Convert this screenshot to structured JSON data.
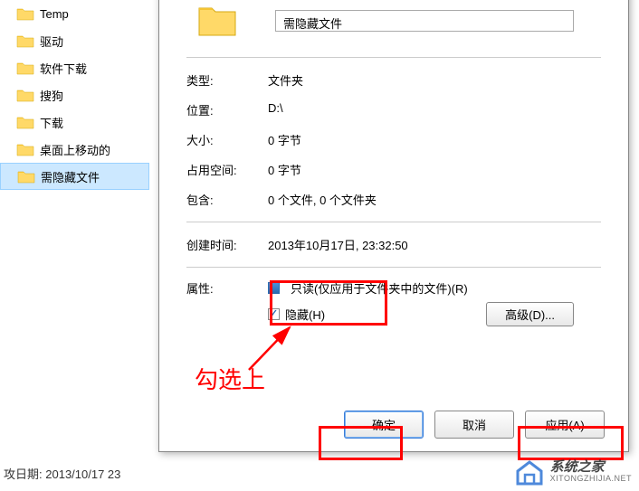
{
  "tree": {
    "items": [
      {
        "label": "Temp"
      },
      {
        "label": "驱动"
      },
      {
        "label": "软件下载"
      },
      {
        "label": "搜狗"
      },
      {
        "label": "下载"
      },
      {
        "label": "桌面上移动的"
      },
      {
        "label": "需隐藏文件"
      }
    ]
  },
  "status": {
    "date_label": "攻日期:",
    "date_value": "2013/10/17 23"
  },
  "dialog": {
    "folder_name": "需隐藏文件",
    "rows": {
      "type_label": "类型:",
      "type_value": "文件夹",
      "location_label": "位置:",
      "location_value": "D:\\",
      "size_label": "大小:",
      "size_value": "0 字节",
      "disk_label": "占用空间:",
      "disk_value": "0 字节",
      "contains_label": "包含:",
      "contains_value": "0 个文件, 0 个文件夹",
      "created_label": "创建时间:",
      "created_value": "2013年10月17日, 23:32:50",
      "attr_label": "属性:",
      "readonly_label": "只读(仅应用于文件夹中的文件)(R)",
      "hidden_label": "隐藏(H)",
      "advanced_label": "高级(D)..."
    },
    "buttons": {
      "ok": "确定",
      "cancel": "取消",
      "apply": "应用(A)"
    }
  },
  "annotation": {
    "text": "勾选上"
  },
  "watermark": {
    "cn": "系统之家",
    "en": "XITONGZHIJIA.NET"
  }
}
